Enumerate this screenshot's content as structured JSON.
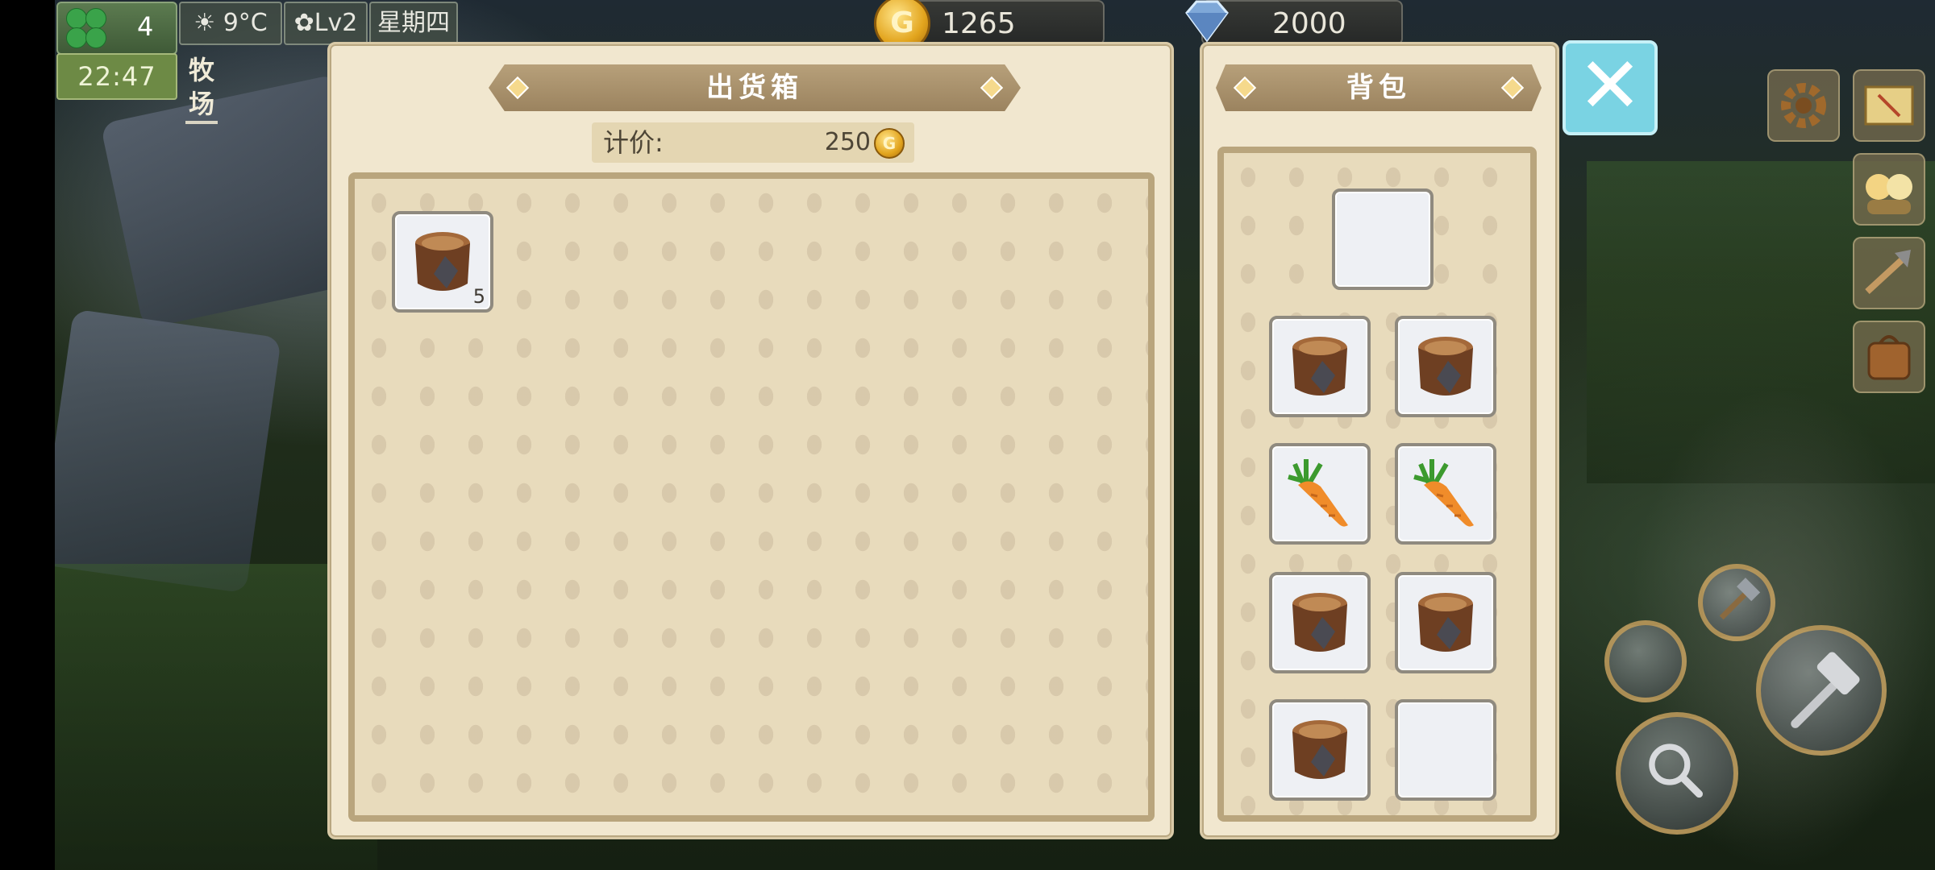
{
  "hud": {
    "clover_count": "4",
    "time": "22:47",
    "weather_temp": "9°C",
    "level": "Lv2",
    "weekday": "星期四",
    "location": "牧场"
  },
  "currency": {
    "gold": "1265",
    "gems": "2000"
  },
  "shipping_panel": {
    "title": "出货箱",
    "price_label": "计价:",
    "price_value": "250",
    "coin_glyph": "G",
    "slots": [
      {
        "item_icon": "tree-stump-icon",
        "qty": "5"
      }
    ]
  },
  "backpack_panel": {
    "title": "背包",
    "slots": [
      {
        "item_icon": "empty"
      },
      {
        "item_icon": "tree-stump-icon"
      },
      {
        "item_icon": "tree-stump-icon"
      },
      {
        "item_icon": "carrot-icon"
      },
      {
        "item_icon": "carrot-icon"
      },
      {
        "item_icon": "tree-stump-icon"
      },
      {
        "item_icon": "tree-stump-icon"
      },
      {
        "item_icon": "tree-stump-icon"
      },
      {
        "item_icon": "empty"
      }
    ]
  },
  "close_glyph": "✕",
  "right_icons": [
    "gear-icon",
    "map-icon",
    "friends-icon",
    "tool-icon",
    "bag-icon"
  ],
  "colors": {
    "panel_bg": "#f1e7cf",
    "ribbon": "#a98f69",
    "close_button": "#7ad3e3",
    "coin": "#e2a41d"
  }
}
